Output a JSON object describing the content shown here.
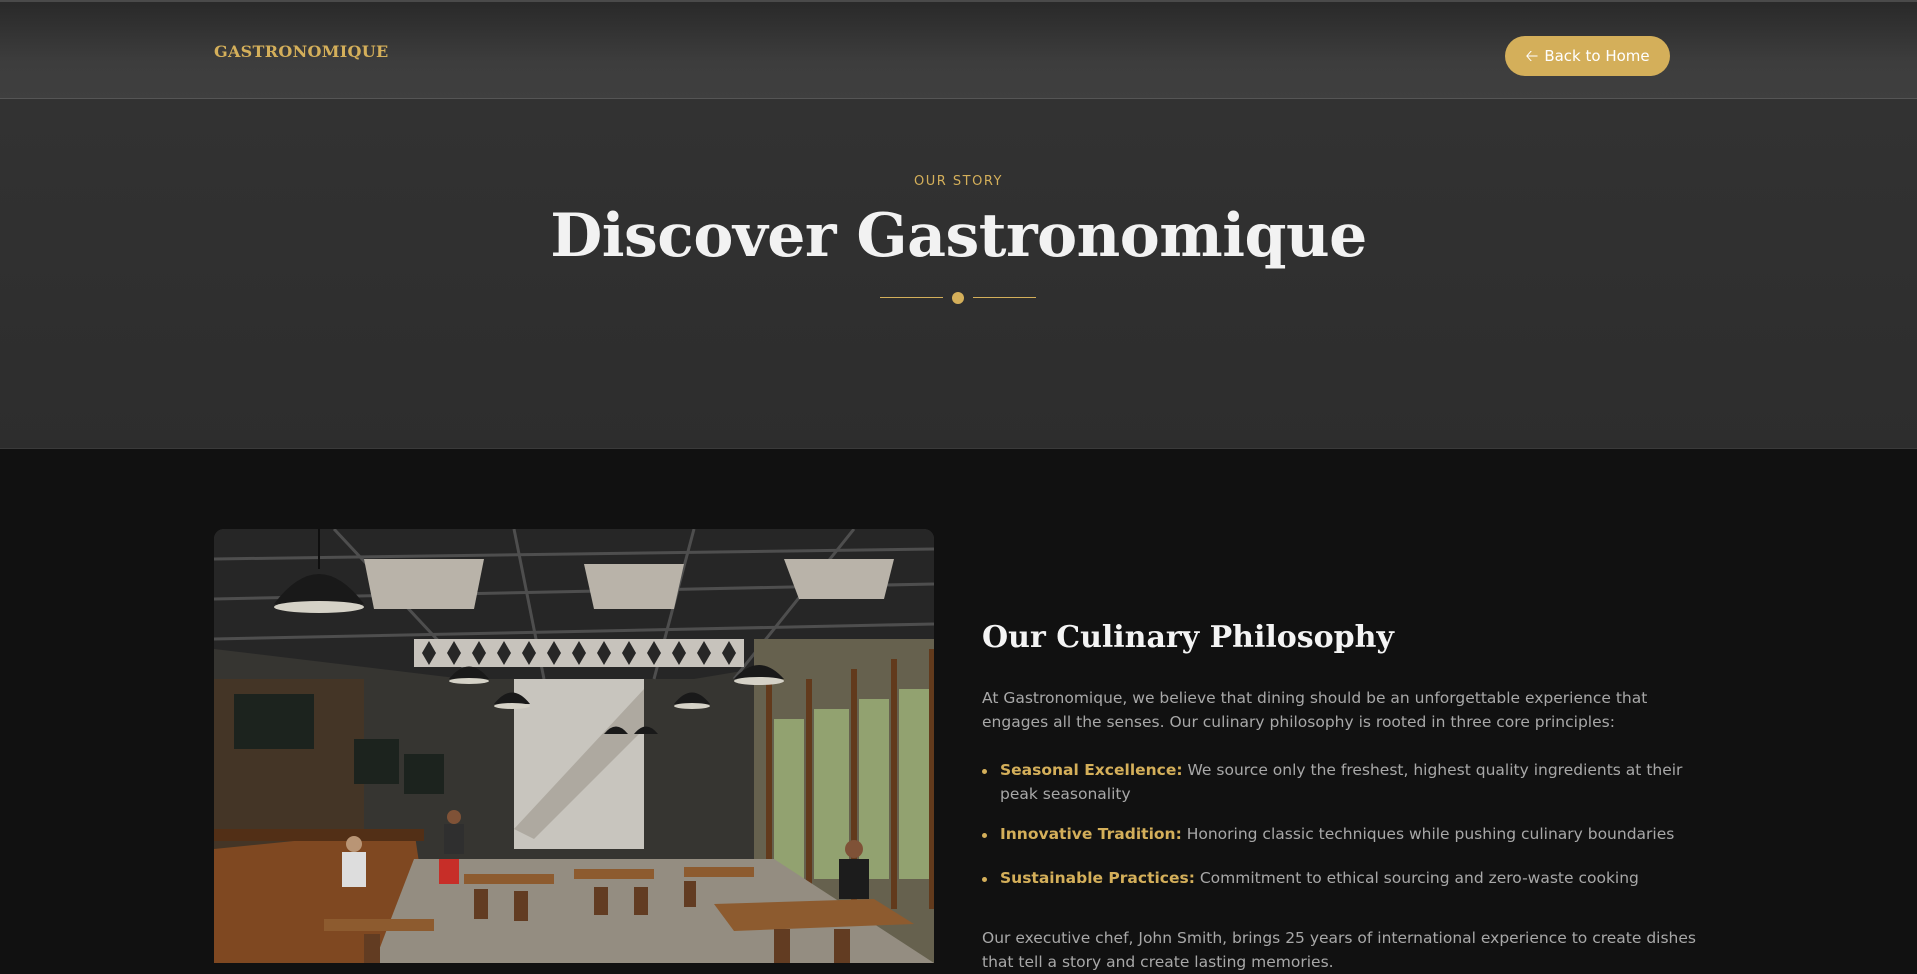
{
  "nav": {
    "brand": "GASTRONOMIQUE",
    "back_label": "Back to Home",
    "back_icon": "arrow-left-icon"
  },
  "hero": {
    "eyebrow": "OUR STORY",
    "title": "Discover Gastronomique"
  },
  "philosophy": {
    "title": "Our Culinary Philosophy",
    "intro": "At Gastronomique, we believe that dining should be an unforgettable experience that engages all the senses. Our culinary philosophy is rooted in three core principles:",
    "principles": [
      {
        "name": "Seasonal Excellence:",
        "text": " We source only the freshest, highest quality ingredients at their peak seasonality"
      },
      {
        "name": "Innovative Tradition:",
        "text": " Honoring classic techniques while pushing culinary boundaries"
      },
      {
        "name": "Sustainable Practices:",
        "text": " Commitment to ethical sourcing and zero-waste cooking"
      }
    ],
    "chef_text": "Our executive chef, John Smith, brings 25 years of international experience to create dishes that tell a story and create lasting memories."
  },
  "colors": {
    "accent": "#d4af5a",
    "page_bg": "#111111",
    "hero_bg": "#303030"
  }
}
